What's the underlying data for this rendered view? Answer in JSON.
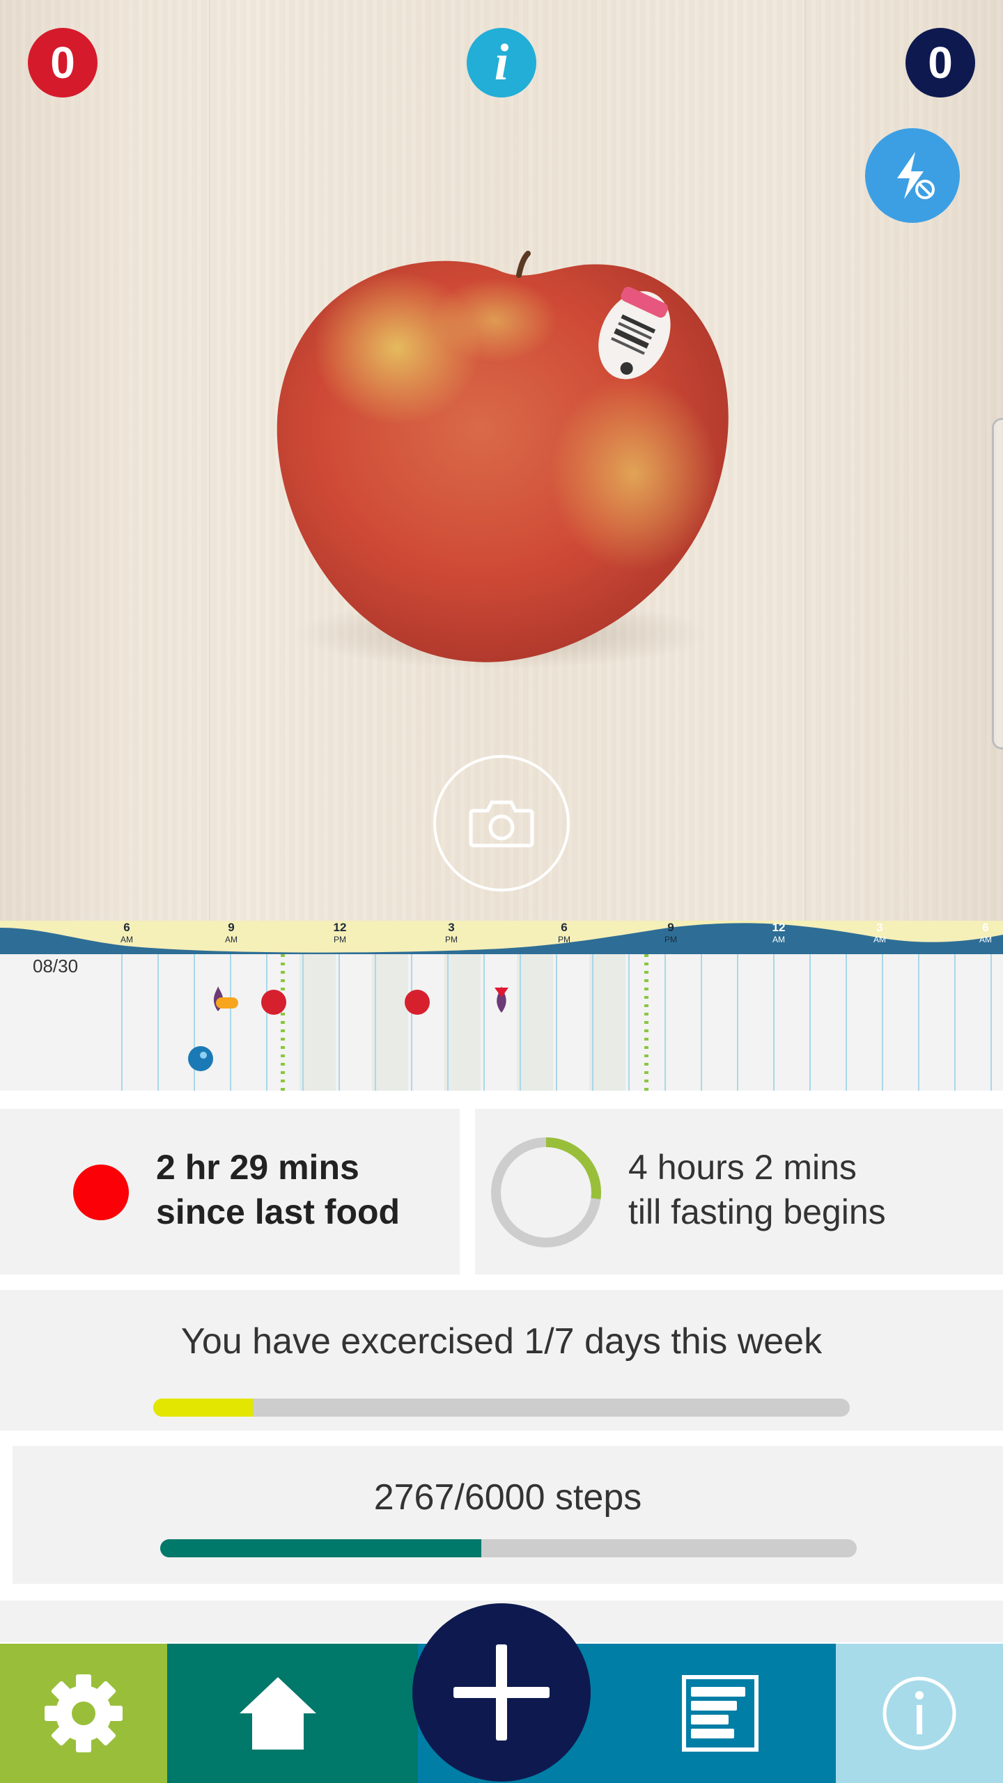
{
  "counters": {
    "left_count": "0",
    "right_count": "0",
    "left_color": "#d51a2b",
    "right_color": "#0e1a4f"
  },
  "top_info_icon": "info-icon",
  "flash_icon": "flash-off-icon",
  "camera_icon": "camera-icon",
  "timeline": {
    "date": "08/30",
    "ticks": [
      {
        "hour": "6",
        "period": "AM"
      },
      {
        "hour": "9",
        "period": "AM"
      },
      {
        "hour": "12",
        "period": "PM"
      },
      {
        "hour": "3",
        "period": "PM"
      },
      {
        "hour": "6",
        "period": "PM"
      },
      {
        "hour": "9",
        "period": "PM"
      },
      {
        "hour": "12",
        "period": "AM"
      },
      {
        "hour": "3",
        "period": "AM"
      },
      {
        "hour": "6",
        "period": "AM"
      }
    ],
    "event_icons": [
      "drop-icon",
      "pill-icon",
      "food-dot-icon",
      "food-dot-icon",
      "food-dot-icon",
      "drop-icon",
      "exercise-ball-icon",
      "now-marker-icon"
    ]
  },
  "food_card": {
    "line1": "2 hr 29 mins",
    "line2": "since last food",
    "dot_color": "#fb0007"
  },
  "fasting_card": {
    "line1": "4 hours 2 mins",
    "line2": "till fasting begins",
    "progress": 0.27,
    "ring_color": "#99bf3a"
  },
  "exercise_card": {
    "title": "You have excercised 1/7 days this week",
    "progress": 0.1428,
    "fill_color": "#e2e600"
  },
  "steps_card": {
    "title": "2767/6000 steps",
    "progress": 0.4612,
    "fill_color": "#00786a"
  },
  "nav": {
    "settings_icon": "gear-icon",
    "home_icon": "home-icon",
    "add_icon": "plus-icon",
    "log_icon": "log-list-icon",
    "info_icon": "info-icon"
  }
}
